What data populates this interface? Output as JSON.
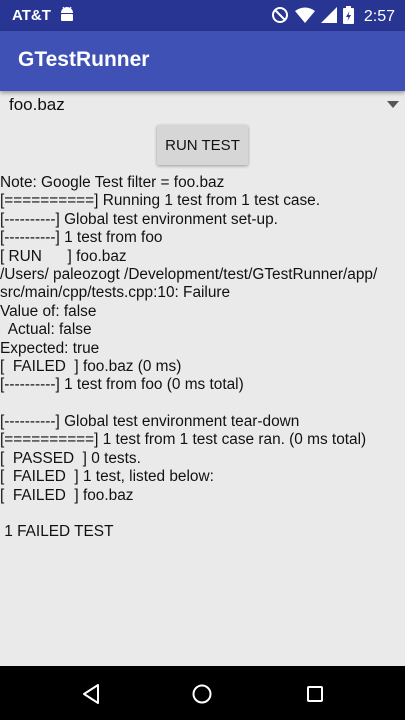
{
  "status_bar": {
    "carrier": "AT&T",
    "time": "2:57",
    "icons": [
      "android-icon",
      "do-not-disturb-icon",
      "wifi-icon",
      "signal-icon",
      "battery-icon"
    ]
  },
  "app": {
    "title": "GTestRunner",
    "colors": {
      "primary": "#3f51b5",
      "primary_dark": "#283593"
    }
  },
  "spinner": {
    "selected": "foo.baz"
  },
  "run_button": {
    "label": "RUN TEST"
  },
  "output": {
    "lines": [
      "Note: Google Test filter = foo.baz",
      "[==========] Running 1 test from 1 test case.",
      "[----------] Global test environment set-up.",
      "[----------] 1 test from foo",
      "[ RUN      ] foo.baz",
      "/Users/ paleozogt /Development/test/GTestRunner/app/",
      "src/main/cpp/tests.cpp:10: Failure",
      "Value of: false",
      "  Actual: false",
      "Expected: true",
      "[  FAILED  ] foo.baz (0 ms)",
      "[----------] 1 test from foo (0 ms total)",
      "",
      "[----------] Global test environment tear-down",
      "[==========] 1 test from 1 test case ran. (0 ms total)",
      "[  PASSED  ] 0 tests.",
      "[  FAILED  ] 1 test, listed below:",
      "[  FAILED  ] foo.baz",
      "",
      " 1 FAILED TEST"
    ]
  }
}
